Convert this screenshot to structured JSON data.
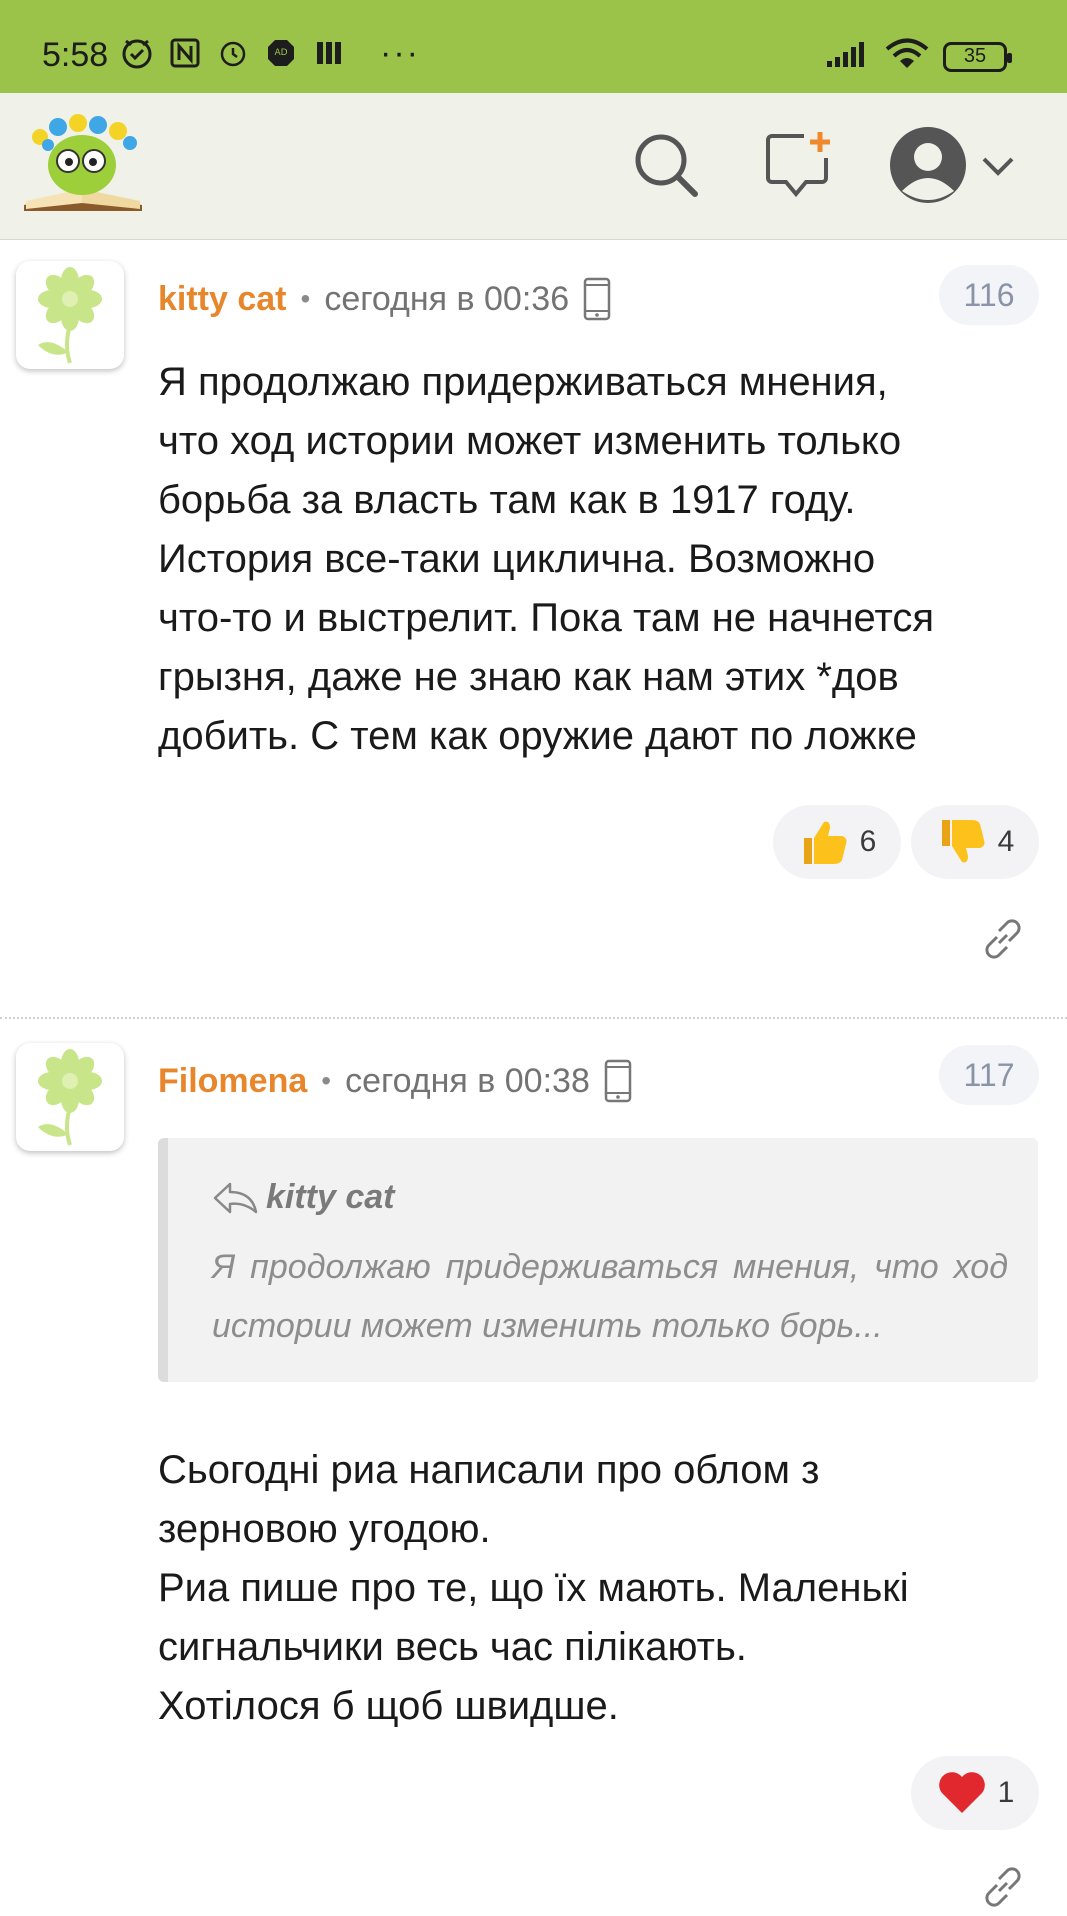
{
  "status_bar": {
    "time": "5:58",
    "battery": "35",
    "more": "···"
  },
  "header": {
    "icons": [
      "logo",
      "search-icon",
      "new-post-icon",
      "avatar-icon",
      "chevron-down-icon"
    ]
  },
  "comments": [
    {
      "author": "kitty cat",
      "separator": "•",
      "time": "сегодня в 00:36",
      "number": "116",
      "text": "Я продолжаю придерживаться мнения,\nчто ход истории может изменить только\nборьба за власть там как в 1917 году.\nИстория все-таки циклична. Возможно\nчто-то и выстрелит. Пока там не начнется\nгрызня, даже не знаю как нам этих *дов\nдобить. С тем как оружие дают по ложке",
      "reactions": [
        {
          "icon": "thumbs-up",
          "count": "6"
        },
        {
          "icon": "thumbs-down",
          "count": "4"
        }
      ]
    },
    {
      "author": "Filomena",
      "separator": "•",
      "time": "сегодня в 00:38",
      "number": "117",
      "quote": {
        "author": "kitty cat",
        "text": "Я продолжаю придерживаться мнения, что ход истории может изменить только борь..."
      },
      "text": "Сьогодні риа написали про облом з\nзерновою угодою.\nРиа пише про те, що їх мають. Маленькі\nсигнальчики весь час пілікають.\nХотілося б щоб швидше.",
      "reactions": [
        {
          "icon": "heart",
          "count": "1"
        }
      ]
    }
  ],
  "colors": {
    "status_bar": "#9bc34a",
    "header_bg": "#f0f1e9",
    "author": "#e8862b"
  }
}
